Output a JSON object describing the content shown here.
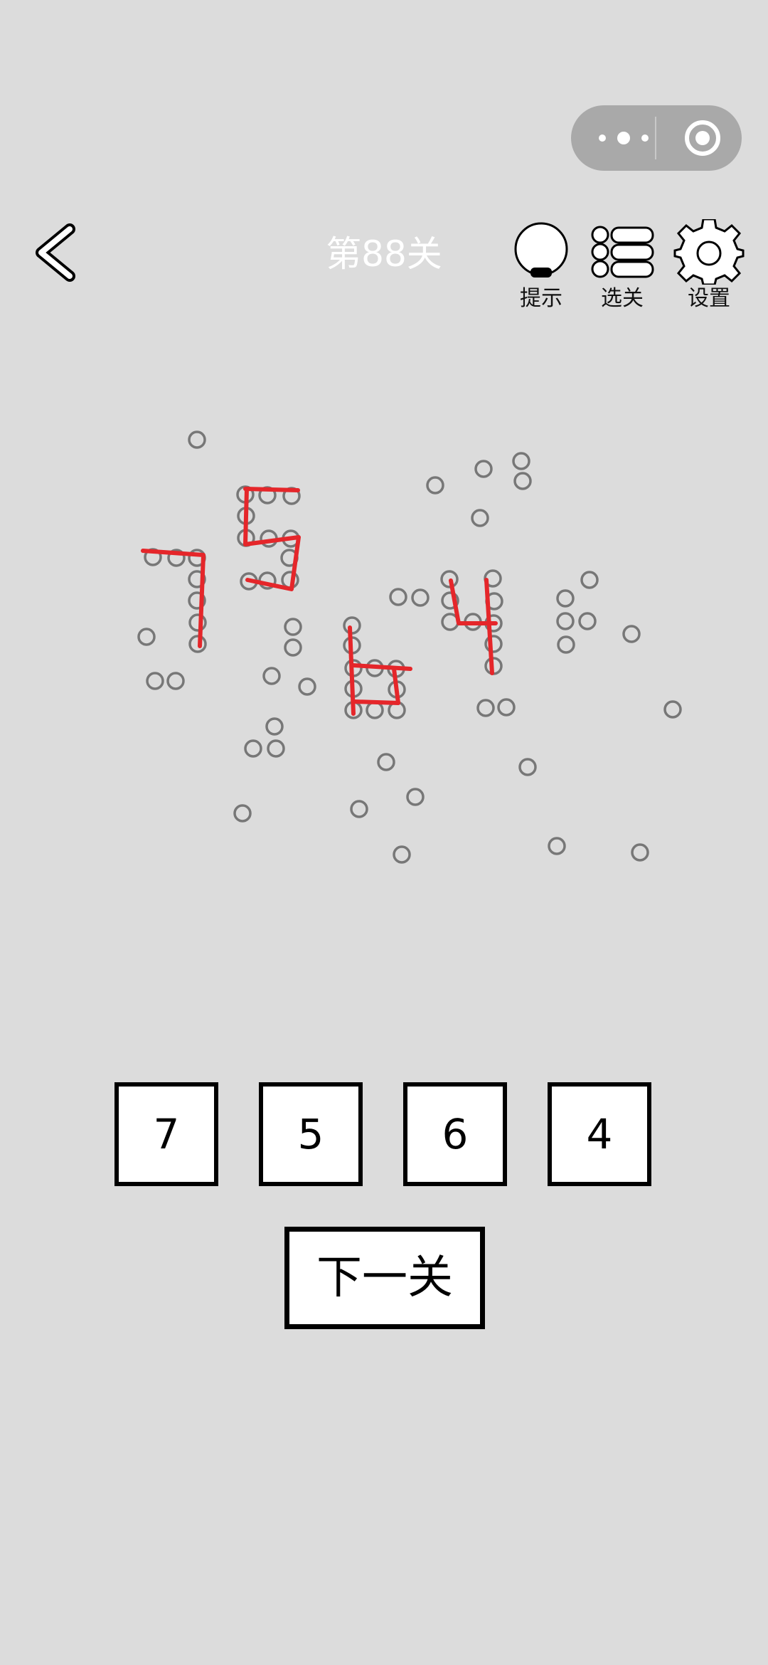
{
  "header": {
    "title": "第88关",
    "hint_label": "提示",
    "levels_label": "选关",
    "settings_label": "设置"
  },
  "colors": {
    "background": "#dcdcdc",
    "dot": "#777777",
    "stroke": "#e5262a"
  },
  "answers": [
    "7",
    "5",
    "6",
    "4"
  ],
  "next_label": "下一关"
}
